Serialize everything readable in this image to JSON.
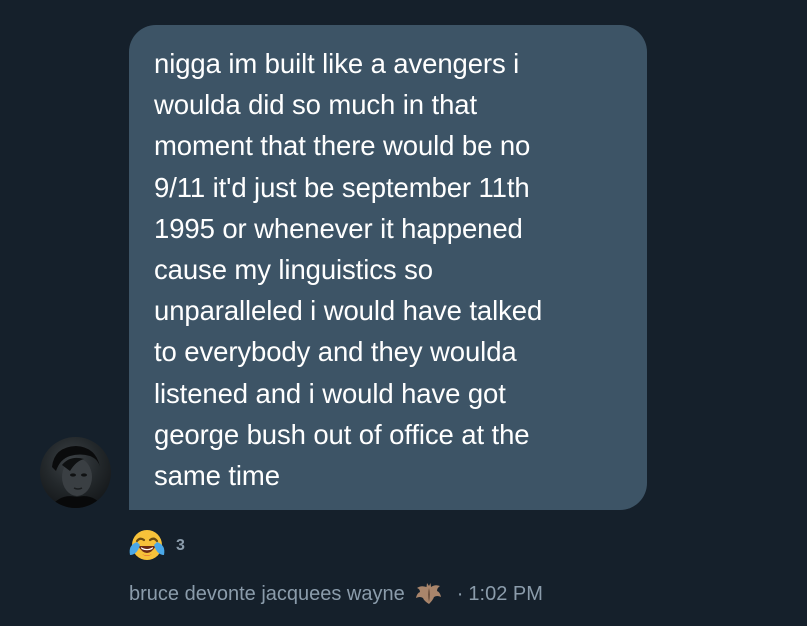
{
  "message": {
    "text": "nigga im built like a avengers i woulda did so much in that moment that there would be no 9/11 it'd just be september 11th 1995 or whenever it happened cause my linguistics so unparalleled i would have talked to everybody and they woulda listened and i would have got george bush out of office at the same time",
    "lines": [
      "nigga im built like a avengers i",
      "woulda did so much in that",
      "moment that there would be no",
      "9/11 it'd just be september 11th",
      "1995 or whenever it happened",
      "cause my linguistics so",
      "unparalleled i would have talked",
      "to everybody and they woulda",
      "listened and i would have got",
      "george bush out of office at the",
      "same time"
    ]
  },
  "reaction": {
    "emoji": "face-with-tears-of-joy-icon",
    "count": "3"
  },
  "sender": {
    "name": "bruce devonte jacquees wayne",
    "badge_icon": "bat-icon",
    "avatar_icon": "avatar-photo"
  },
  "timestamp": {
    "separator": "·",
    "time": "1:02 PM"
  },
  "colors": {
    "background": "#15202b",
    "bubble": "#3d5466",
    "message_text": "#ffffff",
    "meta_text": "#8b9cab"
  }
}
